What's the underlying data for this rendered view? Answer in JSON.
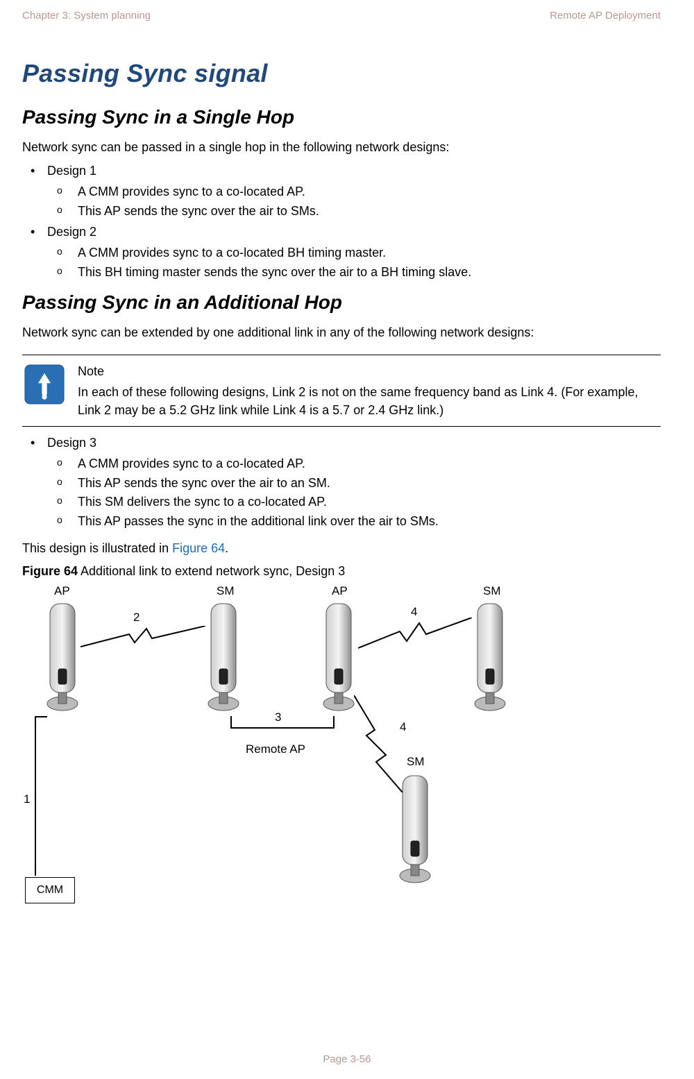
{
  "header": {
    "left": "Chapter 3:  System planning",
    "right": "Remote AP Deployment"
  },
  "title": "Passing Sync signal",
  "section1": {
    "heading": "Passing Sync in a Single Hop",
    "intro": "Network sync can be passed in a single hop in the following network designs:",
    "designs": [
      {
        "label": "Design 1",
        "items": [
          "A CMM provides sync to a co-located AP.",
          "This AP sends the sync over the air to SMs."
        ]
      },
      {
        "label": "Design 2",
        "items": [
          "A CMM provides sync to a co-located BH timing master.",
          "This BH timing master sends the sync over the air to a BH timing slave."
        ]
      }
    ]
  },
  "section2": {
    "heading": "Passing Sync in an Additional Hop",
    "intro": "Network sync can be extended by one additional link in any of the following network designs:"
  },
  "note": {
    "title": "Note",
    "body": "In each of these following designs, Link 2 is not on the same frequency band as Link 4. (For example, Link 2 may be a 5.2 GHz link while Link 4 is a 5.7 or 2.4 GHz link.)"
  },
  "design3": {
    "label": "Design 3",
    "items": [
      "A CMM provides sync to a co-located AP.",
      "This AP sends the sync over the air to an SM.",
      "This SM delivers the sync to a co-located AP.",
      "This AP passes the sync in the additional link over the air to SMs."
    ]
  },
  "refline": {
    "pre": "This design is illustrated in ",
    "ref": "Figure 64",
    "post": "."
  },
  "figure": {
    "no": "Figure 64",
    "caption": " Additional link to extend network sync, Design 3",
    "labels": {
      "ap1": "AP",
      "sm1": "SM",
      "ap2": "AP",
      "sm2": "SM",
      "sm3": "SM",
      "remote": "Remote AP",
      "n1": "1",
      "n2": "2",
      "n3": "3",
      "n4a": "4",
      "n4b": "4",
      "cmm": "CMM"
    }
  },
  "footer": "Page 3-56"
}
